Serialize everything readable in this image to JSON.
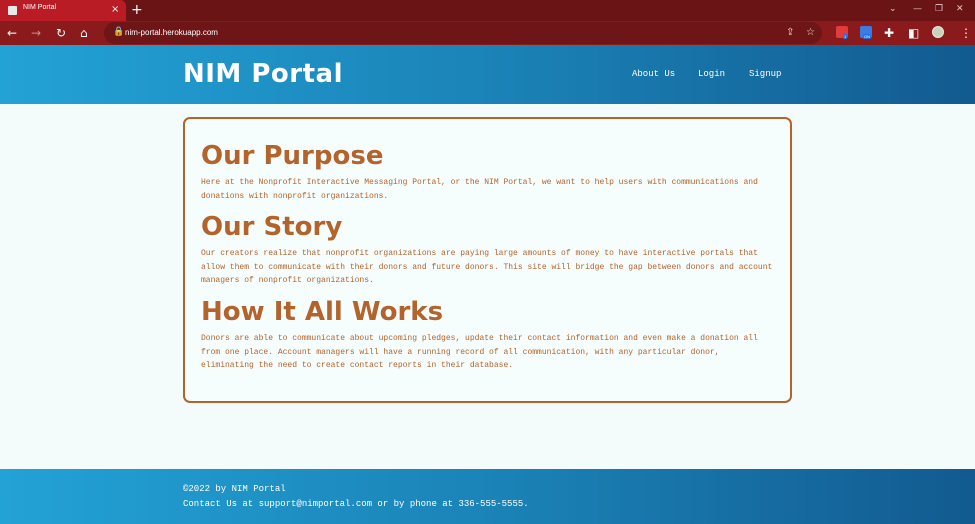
{
  "browser": {
    "tab_title": "NIM Portal",
    "tab_close": "×",
    "new_tab": "+",
    "url": "nim-portal.herokuapp.com",
    "ext_badges": [
      "1",
      "ON"
    ]
  },
  "header": {
    "brand": "NIM Portal",
    "nav": [
      "About Us",
      "Login",
      "Signup"
    ]
  },
  "sections": [
    {
      "title": "Our Purpose",
      "text": "Here at the Nonprofit Interactive Messaging Portal, or the NIM Portal, we want to help users with communications and donations with nonprofit organizations."
    },
    {
      "title": "Our Story",
      "text": "Our creators realize that nonprofit organizations are paying large amounts of money to have interactive portals that allow them to communicate with their donors and future donors. This site will bridge the gap between donors and account managers of nonprofit organizations."
    },
    {
      "title": "How It All Works",
      "text": "Donors are able to communicate about upcoming pledges, update their contact information and even make a donation all from one place. Account managers will have a running record of all communication, with any particular donor, eliminating the need to create contact reports in their database."
    }
  ],
  "footer": {
    "copyright": "©2022 by NIM Portal",
    "contact": "Contact Us at support@nimportal.com or by phone at 336-555-5555."
  },
  "colors": {
    "accent": "#b3632c",
    "header_start": "#23a2d6",
    "header_end": "#125a90",
    "chrome": "#8b1a1d"
  }
}
